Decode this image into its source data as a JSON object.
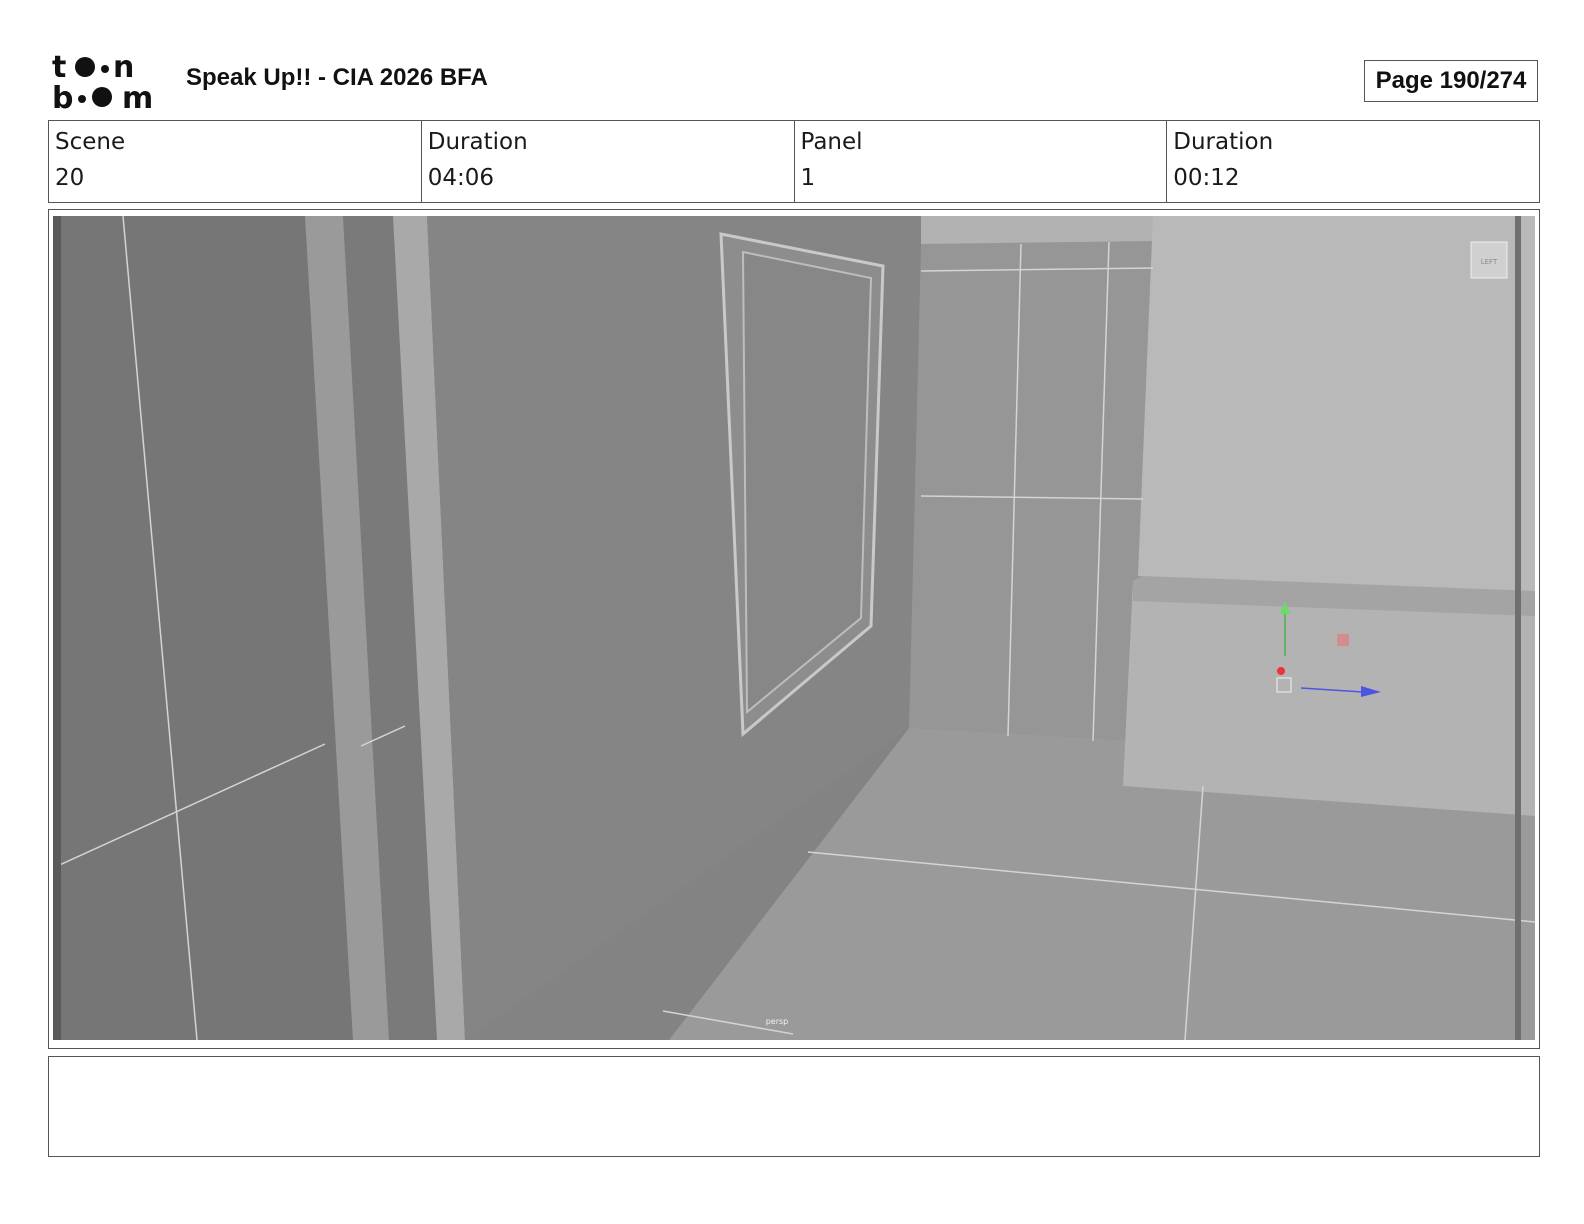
{
  "header": {
    "brand": "toon boom",
    "title": "Speak Up!! - CIA 2026 BFA",
    "page_label": "Page 190/274"
  },
  "info": [
    {
      "label": "Scene",
      "value": "20"
    },
    {
      "label": "Duration",
      "value": "04:06"
    },
    {
      "label": "Panel",
      "value": "1"
    },
    {
      "label": "Duration",
      "value": "00:12"
    }
  ],
  "viewport": {
    "camera_label": "persp",
    "view_cube_label": "LEFT"
  },
  "notes": ""
}
